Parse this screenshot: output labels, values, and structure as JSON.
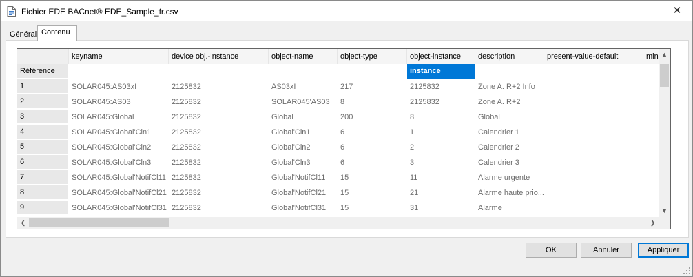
{
  "window": {
    "title": "Fichier EDE BACnet® EDE_Sample_fr.csv",
    "close_glyph": "✕",
    "icon": "file-document-icon"
  },
  "tabs": [
    {
      "label": "Général"
    },
    {
      "label": "Contenu"
    }
  ],
  "grid": {
    "columns": [
      "keyname",
      "device obj.-instance",
      "object-name",
      "object-type",
      "object-instance",
      "description",
      "present-value-default",
      "min-pre"
    ],
    "reference_row": {
      "label": "Référence",
      "cells": [
        "",
        "",
        "",
        "",
        "instance",
        "",
        "",
        ""
      ]
    },
    "rows": [
      {
        "n": "1",
        "cells": [
          "SOLAR045:AS03xI",
          "2125832",
          "AS03xI",
          "217",
          "2125832",
          "Zone A. R+2 Info",
          "",
          ""
        ]
      },
      {
        "n": "2",
        "cells": [
          "SOLAR045:AS03",
          "2125832",
          "SOLAR045'AS03",
          "8",
          "2125832",
          "Zone A. R+2",
          "",
          ""
        ]
      },
      {
        "n": "3",
        "cells": [
          "SOLAR045:Global",
          "2125832",
          "Global",
          "200",
          "8",
          "Global",
          "",
          ""
        ]
      },
      {
        "n": "4",
        "cells": [
          "SOLAR045:Global'Cln1",
          "2125832",
          "Global'Cln1",
          "6",
          "1",
          "Calendrier 1",
          "",
          ""
        ]
      },
      {
        "n": "5",
        "cells": [
          "SOLAR045:Global'Cln2",
          "2125832",
          "Global'Cln2",
          "6",
          "2",
          "Calendrier 2",
          "",
          ""
        ]
      },
      {
        "n": "6",
        "cells": [
          "SOLAR045:Global'Cln3",
          "2125832",
          "Global'Cln3",
          "6",
          "3",
          "Calendrier 3",
          "",
          ""
        ]
      },
      {
        "n": "7",
        "cells": [
          "SOLAR045:Global'NotifCl11",
          "2125832",
          "Global'NotifCl11",
          "15",
          "11",
          "Alarme urgente",
          "",
          ""
        ]
      },
      {
        "n": "8",
        "cells": [
          "SOLAR045:Global'NotifCl21",
          "2125832",
          "Global'NotifCl21",
          "15",
          "21",
          "Alarme haute prio...",
          "",
          ""
        ]
      },
      {
        "n": "9",
        "cells": [
          "SOLAR045:Global'NotifCl31",
          "2125832",
          "Global'NotifCl31",
          "15",
          "31",
          "Alarme",
          "",
          ""
        ]
      }
    ],
    "scroll": {
      "up": "▲",
      "down": "▼",
      "left": "❮",
      "right": "❯"
    }
  },
  "buttons": {
    "ok": "OK",
    "cancel": "Annuler",
    "apply": "Appliquer"
  },
  "colors": {
    "selection": "#0078d7",
    "cell_text": "#6d6d6d"
  }
}
